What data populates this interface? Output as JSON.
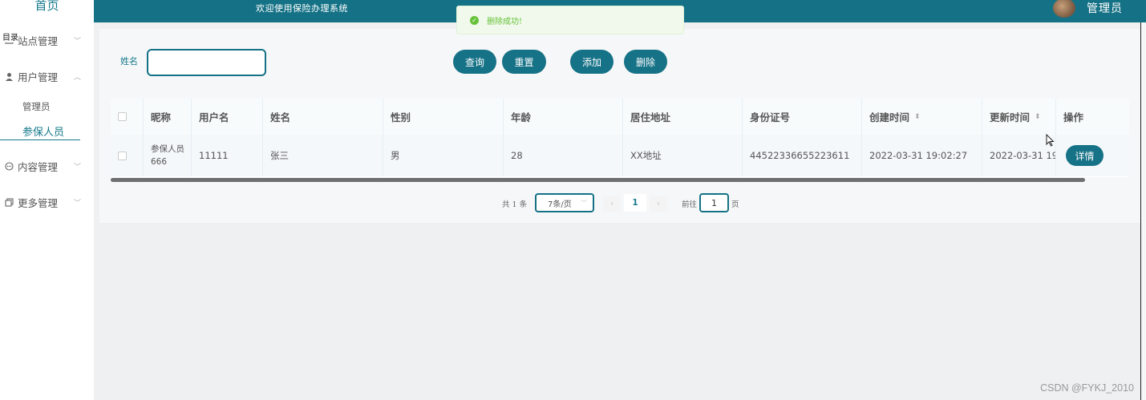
{
  "sidebar": {
    "home": "首页",
    "glitch": "目录",
    "menus": [
      {
        "label": "站点管理",
        "icon": "tag-icon"
      },
      {
        "label": "用户管理",
        "icon": "user-icon"
      },
      {
        "label": "内容管理",
        "icon": "chat-icon"
      },
      {
        "label": "更多管理",
        "icon": "copy-icon"
      }
    ],
    "sub_items": [
      "管理员",
      "参保人员"
    ]
  },
  "header": {
    "welcome": "欢迎使用保险办理系统",
    "admin": "管理员"
  },
  "toast": {
    "message": "删除成功!"
  },
  "search": {
    "label": "姓名",
    "value": ""
  },
  "buttons": {
    "query": "查询",
    "reset": "重置",
    "add": "添加",
    "delete": "删除"
  },
  "table": {
    "headers": [
      "昵称",
      "用户名",
      "姓名",
      "性别",
      "年龄",
      "居住地址",
      "身份证号",
      "创建时间",
      "更新时间",
      "操作"
    ],
    "row": {
      "nickname": "参保人员666",
      "username": "11111",
      "name": "张三",
      "gender": "男",
      "age": "28",
      "address": "XX地址",
      "idcard": "445223366552236​11",
      "created": "2022-03-31 19:02:27",
      "updated": "2022-03-31 19:",
      "action": "详情"
    }
  },
  "pagination": {
    "total": "共 1 条",
    "page_size": "7条/页",
    "current_page": "1",
    "goto_label": "前往",
    "goto_value": "1",
    "page_suffix": "页"
  },
  "watermark": "CSDN @FYKJ_2010"
}
